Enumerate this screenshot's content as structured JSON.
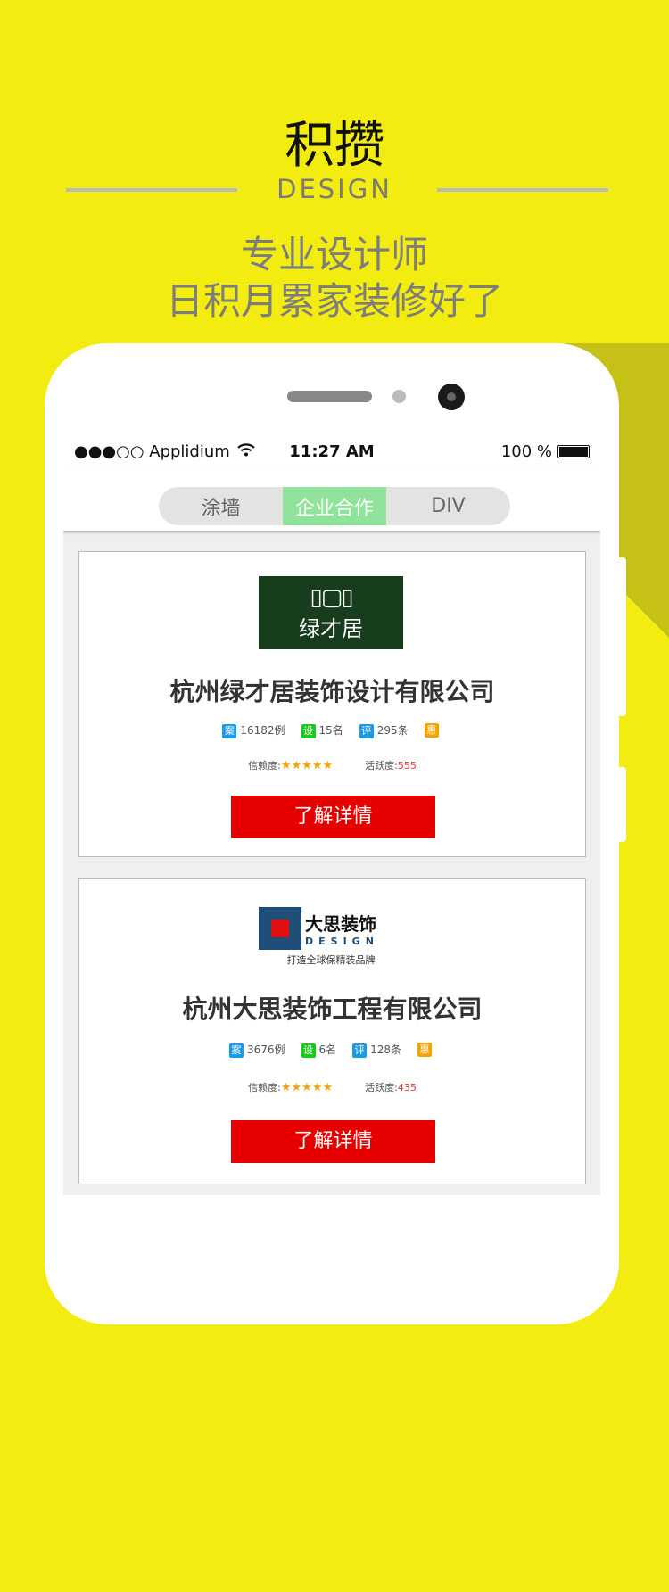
{
  "promo": {
    "title": "积攒",
    "subtitle_en": "DESIGN",
    "line1": "专业设计师",
    "line2": "日积月累家装修好了"
  },
  "status": {
    "carrier": "●●●○○ Applidium",
    "time": "11:27 AM",
    "battery": "100 %"
  },
  "tabs": [
    {
      "label": "涂墙"
    },
    {
      "label": "企业合作"
    },
    {
      "label": "DIV"
    }
  ],
  "colors": {
    "background": "#f2ec10",
    "accent": "#e60000",
    "active_tab": "#8fe39a"
  },
  "badges": {
    "cases": "案",
    "designers": "设",
    "reviews": "评",
    "discount": "惠"
  },
  "companies": [
    {
      "name": "杭州绿才居装饰设计有限公司",
      "logo_text": "绿才居",
      "cases": "16182例",
      "designers": "15名",
      "reviews": "295条",
      "trust_label": "信赖度:",
      "stars": "★★★★★",
      "activity_label": "活跃度:",
      "activity": "555",
      "button": "了解详情"
    },
    {
      "name": "杭州大思装饰工程有限公司",
      "logo_text": "大思装饰 DESIGN 打造全球保精装品牌",
      "cases": "3676例",
      "designers": "6名",
      "reviews": "128条",
      "trust_label": "信赖度:",
      "stars": "★★★★★",
      "activity_label": "活跃度:",
      "activity": "435",
      "button": "了解详情"
    }
  ]
}
